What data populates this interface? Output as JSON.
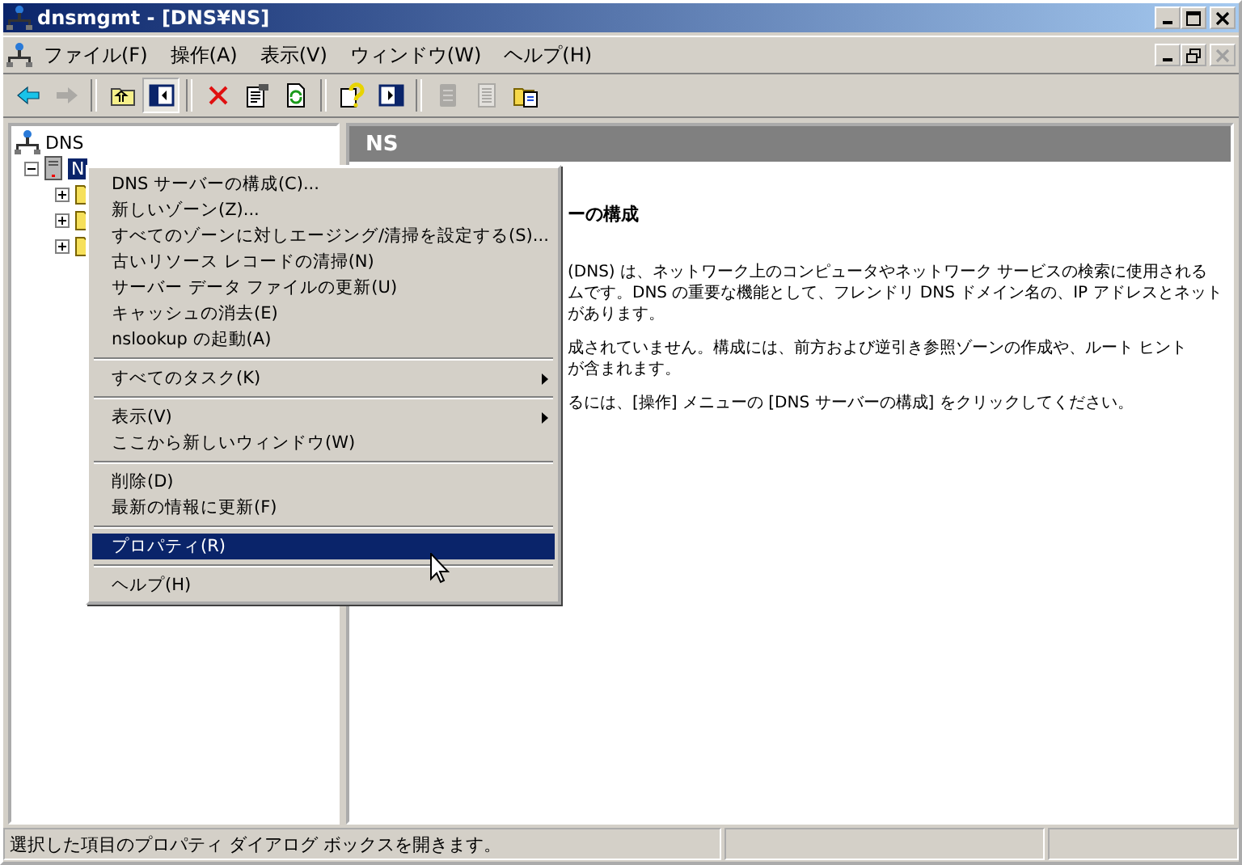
{
  "window": {
    "title": "dnsmgmt - [DNS¥NS]"
  },
  "menubar": [
    {
      "label": "ファイル(F)"
    },
    {
      "label": "操作(A)"
    },
    {
      "label": "表示(V)"
    },
    {
      "label": "ウィンドウ(W)"
    },
    {
      "label": "ヘルプ(H)"
    }
  ],
  "toolbar": [
    {
      "kind": "back",
      "disabled": false,
      "pressed": false
    },
    {
      "kind": "forward",
      "disabled": true,
      "pressed": false
    },
    {
      "kind": "separator"
    },
    {
      "kind": "up",
      "disabled": false,
      "pressed": false
    },
    {
      "kind": "tree",
      "disabled": false,
      "pressed": true
    },
    {
      "kind": "separator"
    },
    {
      "kind": "delete",
      "disabled": false,
      "pressed": false
    },
    {
      "kind": "properties",
      "disabled": false,
      "pressed": false
    },
    {
      "kind": "refresh",
      "disabled": false,
      "pressed": false
    },
    {
      "kind": "separator"
    },
    {
      "kind": "help",
      "disabled": false,
      "pressed": false
    },
    {
      "kind": "panel",
      "disabled": false,
      "pressed": false
    },
    {
      "kind": "separator"
    },
    {
      "kind": "doc",
      "disabled": true,
      "pressed": false
    },
    {
      "kind": "list",
      "disabled": true,
      "pressed": false
    },
    {
      "kind": "copy",
      "disabled": false,
      "pressed": false
    }
  ],
  "tree": {
    "label": "DNS",
    "children": [
      {
        "label": "N",
        "selected": true,
        "expanded": true,
        "children": [
          {
            "expanded": false
          },
          {
            "expanded": false
          },
          {
            "expanded": false
          }
        ]
      }
    ]
  },
  "detail": {
    "header": "NS",
    "heading": "ーの構成",
    "paragraphs": [
      [
        "(DNS) は、ネットワーク上のコンピュータやネットワーク サービスの検索に使用される",
        "ムです。DNS の重要な機能として、フレンドリ DNS ドメイン名の、IP アドレスとネット",
        "があります。"
      ],
      [
        "成されていません。構成には、前方および逆引き参照ゾーンの作成や、ルート ヒント",
        "が含まれます。"
      ],
      [
        "るには、[操作] メニューの [DNS サーバーの構成] をクリックしてください。"
      ]
    ]
  },
  "context_menu": [
    {
      "kind": "item",
      "label": "DNS サーバーの構成(C)...",
      "submenu": false,
      "selected": false
    },
    {
      "kind": "item",
      "label": "新しいゾーン(Z)...",
      "submenu": false,
      "selected": false
    },
    {
      "kind": "item",
      "label": "すべてのゾーンに対しエージング/清掃を設定する(S)...",
      "submenu": false,
      "selected": false
    },
    {
      "kind": "item",
      "label": "古いリソース レコードの清掃(N)",
      "submenu": false,
      "selected": false
    },
    {
      "kind": "item",
      "label": "サーバー データ ファイルの更新(U)",
      "submenu": false,
      "selected": false
    },
    {
      "kind": "item",
      "label": "キャッシュの消去(E)",
      "submenu": false,
      "selected": false
    },
    {
      "kind": "item",
      "label": "nslookup の起動(A)",
      "submenu": false,
      "selected": false
    },
    {
      "kind": "separator"
    },
    {
      "kind": "item",
      "label": "すべてのタスク(K)",
      "submenu": true,
      "selected": false
    },
    {
      "kind": "separator"
    },
    {
      "kind": "item",
      "label": "表示(V)",
      "submenu": true,
      "selected": false
    },
    {
      "kind": "item",
      "label": "ここから新しいウィンドウ(W)",
      "submenu": false,
      "selected": false
    },
    {
      "kind": "separator"
    },
    {
      "kind": "item",
      "label": "削除(D)",
      "submenu": false,
      "selected": false
    },
    {
      "kind": "item",
      "label": "最新の情報に更新(F)",
      "submenu": false,
      "selected": false
    },
    {
      "kind": "separator"
    },
    {
      "kind": "item",
      "label": "プロパティ(R)",
      "submenu": false,
      "selected": true
    },
    {
      "kind": "separator"
    },
    {
      "kind": "item",
      "label": "ヘルプ(H)",
      "submenu": false,
      "selected": false
    }
  ],
  "status_bar": {
    "text": "選択した項目のプロパティ ダイアログ ボックスを開きます。"
  }
}
